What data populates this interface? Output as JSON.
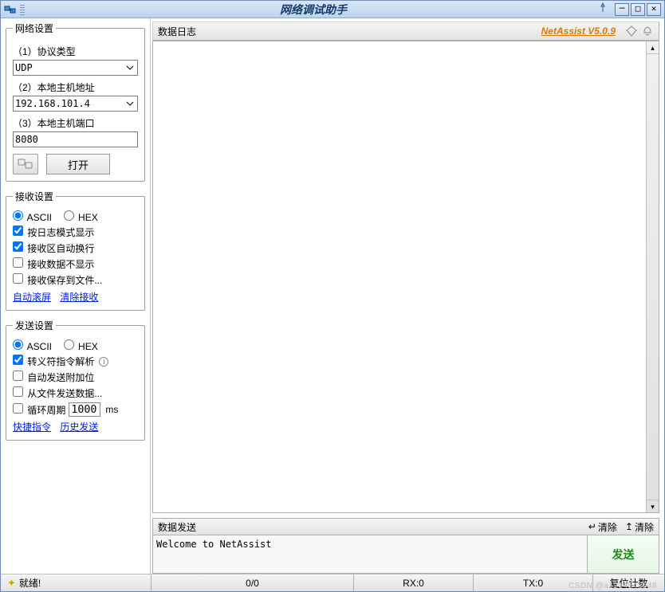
{
  "title": "网络调试助手",
  "version_label": "NetAssist V5.0.9",
  "left": {
    "network": {
      "legend": "网络设置",
      "protocol_label": "（1）协议类型",
      "protocol_value": "UDP",
      "host_label": "（2）本地主机地址",
      "host_value": "192.168.101.4",
      "port_label": "（3）本地主机端口",
      "port_value": "8080",
      "open_label": "打开"
    },
    "recv": {
      "legend": "接收设置",
      "ascii": "ASCII",
      "hex": "HEX",
      "opt_log": "按日志模式显示",
      "opt_wrap": "接收区自动换行",
      "opt_hide": "接收数据不显示",
      "opt_save": "接收保存到文件...",
      "link_scroll": "自动滚屏",
      "link_clear": "清除接收"
    },
    "send": {
      "legend": "发送设置",
      "ascii": "ASCII",
      "hex": "HEX",
      "opt_escape": "转义符指令解析",
      "opt_append": "自动发送附加位",
      "opt_file": "从文件发送数据...",
      "opt_cycle": "循环周期",
      "cycle_value": "1000",
      "cycle_unit": "ms",
      "link_quick": "快捷指令",
      "link_hist": "历史发送"
    }
  },
  "right": {
    "log_label": "数据日志",
    "send_label": "数据发送",
    "clear_left": "清除",
    "clear_right": "清除",
    "send_text": "Welcome to NetAssist",
    "send_btn": "发送"
  },
  "status": {
    "ready": "就绪!",
    "counter": "0/0",
    "rx": "RX:0",
    "tx": "TX:0",
    "reset": "复位计数"
  },
  "watermark": "CSDN @a1234543548"
}
